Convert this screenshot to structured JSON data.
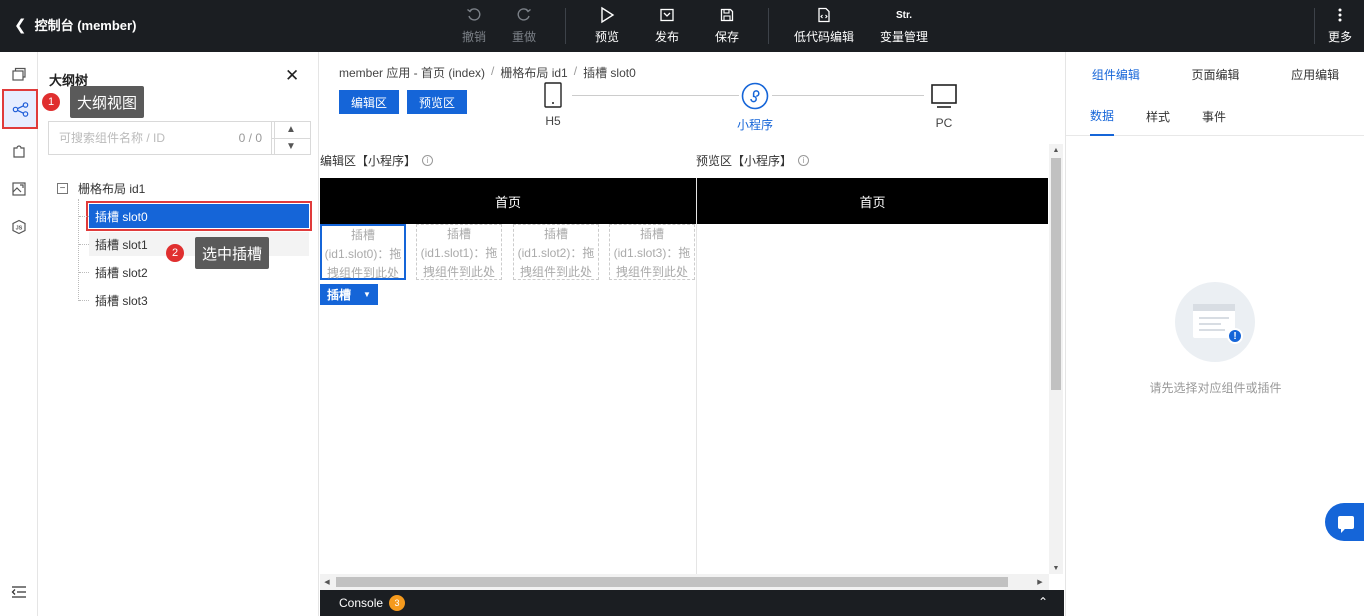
{
  "header": {
    "back_label": "控制台 (member)",
    "toolbar": [
      {
        "label": "撤销",
        "icon": "undo-icon",
        "disabled": true
      },
      {
        "label": "重做",
        "icon": "redo-icon",
        "disabled": true
      },
      {
        "label": "预览",
        "icon": "play-icon",
        "disabled": false
      },
      {
        "label": "发布",
        "icon": "publish-icon",
        "disabled": false
      },
      {
        "label": "保存",
        "icon": "save-icon",
        "disabled": false
      },
      {
        "label": "低代码编辑",
        "icon": "lowcode-icon",
        "disabled": false
      },
      {
        "label": "变量管理",
        "icon": "variable-icon",
        "icon_text": "Str.",
        "disabled": false
      },
      {
        "label": "更多",
        "icon": "more-vertical-icon",
        "disabled": false
      }
    ]
  },
  "outline": {
    "title": "大纲树",
    "search": {
      "placeholder": "可搜索组件名称 / ID",
      "count": "0 / 0"
    },
    "root": {
      "label": "栅格布局 id1"
    },
    "items": [
      {
        "label": "插槽 slot0",
        "selected": true
      },
      {
        "label": "插槽 slot1",
        "selected": false
      },
      {
        "label": "插槽 slot2",
        "selected": false
      },
      {
        "label": "插槽 slot3",
        "selected": false
      }
    ]
  },
  "callouts": [
    {
      "number": "1",
      "text": "大纲视图"
    },
    {
      "number": "2",
      "text": "选中插槽"
    }
  ],
  "center": {
    "breadcrumb": [
      "member 应用 - 首页 (index)",
      "栅格布局 id1",
      "插槽 slot0"
    ],
    "breadcrumb_sep": "/",
    "mode_buttons": [
      "编辑区",
      "预览区"
    ],
    "devices": [
      {
        "label": "H5",
        "icon": "phone-icon",
        "active": false
      },
      {
        "label": "小程序",
        "icon": "miniprogram-icon",
        "active": true
      },
      {
        "label": "PC",
        "icon": "monitor-icon",
        "active": false
      }
    ],
    "edit_pane": {
      "header": "编辑区【小程序】",
      "page_title": "首页"
    },
    "preview_pane": {
      "header": "预览区【小程序】",
      "page_title": "首页"
    },
    "slots": [
      "插槽(id1.slot0)：拖拽组件到此处",
      "插槽(id1.slot1)：拖拽组件到此处",
      "插槽(id1.slot2)：拖拽组件到此处",
      "插槽(id1.slot3)：拖拽组件到此处"
    ],
    "slot_tag": "插槽",
    "console": {
      "label": "Console",
      "badge": "3"
    }
  },
  "right_panel": {
    "tabs": [
      {
        "label": "组件编辑",
        "active": true
      },
      {
        "label": "页面编辑",
        "active": false
      },
      {
        "label": "应用编辑",
        "active": false
      }
    ],
    "subtabs": [
      {
        "label": "数据",
        "active": true
      },
      {
        "label": "样式",
        "active": false
      },
      {
        "label": "事件",
        "active": false
      }
    ],
    "empty_text": "请先选择对应组件或插件"
  },
  "colors": {
    "accent": "#1565d8",
    "topbar": "#1b1e22",
    "callout_red": "#e02f2f",
    "console_badge": "#f59a1d"
  }
}
